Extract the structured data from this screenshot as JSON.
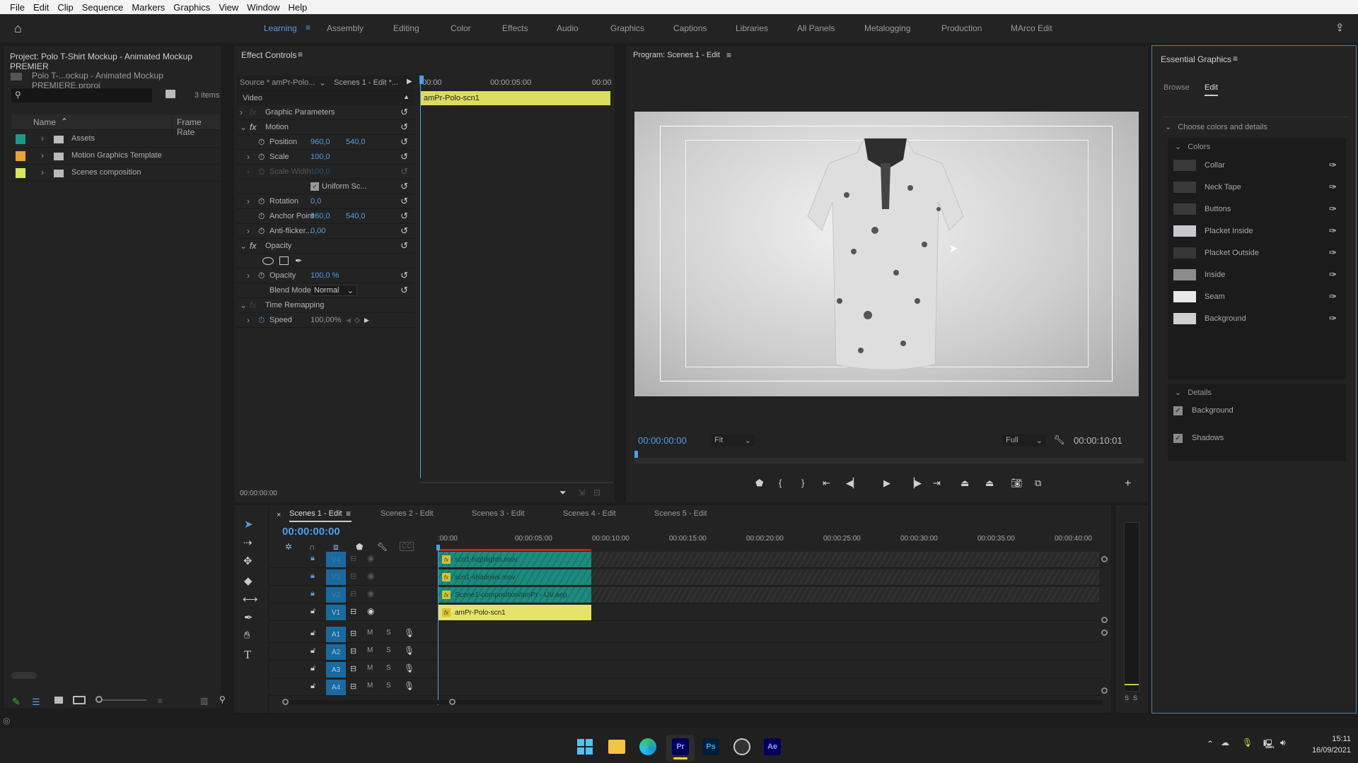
{
  "menu": [
    "File",
    "Edit",
    "Clip",
    "Sequence",
    "Markers",
    "Graphics",
    "View",
    "Window",
    "Help"
  ],
  "workspaces": [
    {
      "label": "Learning",
      "active": true
    },
    {
      "label": "Assembly"
    },
    {
      "label": "Editing"
    },
    {
      "label": "Color"
    },
    {
      "label": "Effects"
    },
    {
      "label": "Audio"
    },
    {
      "label": "Graphics"
    },
    {
      "label": "Captions"
    },
    {
      "label": "Libraries"
    },
    {
      "label": "All Panels"
    },
    {
      "label": "Metalogging"
    },
    {
      "label": "Production"
    },
    {
      "label": "MArco Edit"
    }
  ],
  "project": {
    "title": "Project: Polo T-Shirt Mockup - Animated Mockup PREMIER",
    "file": "Polo T-...ockup - Animated Mockup PREMIERE.prproj",
    "search_placeholder": "",
    "count": "3 items",
    "col_name": "Name",
    "col_framerate": "Frame Rate",
    "items": [
      {
        "name": "Assets",
        "color": "#1a9a8a"
      },
      {
        "name": "Motion Graphics Template",
        "color": "#e8a23a"
      },
      {
        "name": "Scenes composition",
        "color": "#d8e85a"
      }
    ]
  },
  "effect_controls": {
    "title": "Effect Controls",
    "source": "Source * amPr-Polo...",
    "sequence": "Scenes 1 - Edit *...",
    "ruler": [
      "00:00",
      "00:00:05:00",
      "00:00"
    ],
    "clip_name": "amPr-Polo-scn1",
    "video_label": "Video",
    "rows": [
      {
        "label": "Graphic Parameters",
        "type": "fx-dim"
      },
      {
        "label": "Motion",
        "type": "fx"
      },
      {
        "label": "Position",
        "v1": "960,0",
        "v2": "540,0"
      },
      {
        "label": "Scale",
        "v1": "100,0"
      },
      {
        "label": "Scale Width",
        "v1": "100,0",
        "disabled": true
      },
      {
        "label": "Uniform Sc...",
        "type": "check"
      },
      {
        "label": "Rotation",
        "v1": "0,0"
      },
      {
        "label": "Anchor Point",
        "v1": "960,0",
        "v2": "540,0"
      },
      {
        "label": "Anti-flicker...",
        "v1": "0,00"
      },
      {
        "label": "Opacity",
        "type": "fx"
      },
      {
        "label": "",
        "type": "masks"
      },
      {
        "label": "Opacity",
        "v1": "100,0 %"
      },
      {
        "label": "Blend Mode",
        "type": "select",
        "v1": "Normal"
      },
      {
        "label": "Time Remapping",
        "type": "fx-dim"
      },
      {
        "label": "Speed",
        "v1": "100,00%"
      }
    ],
    "timecode": "00:00:00:00"
  },
  "program": {
    "title": "Program: Scenes 1 - Edit",
    "timecode": "00:00:00:00",
    "fit": "Fit",
    "quality": "Full",
    "duration": "00:00:10:01"
  },
  "essential_graphics": {
    "title": "Essential Graphics",
    "tabs": [
      "Browse",
      "Edit"
    ],
    "active_tab": "Edit",
    "section": "Choose colors and details",
    "colors_label": "Colors",
    "colors": [
      {
        "name": "Collar",
        "swatch": "#3a3a3a"
      },
      {
        "name": "Neck Tape",
        "swatch": "#3a3a3a"
      },
      {
        "name": "Buttons",
        "swatch": "#3a3a3a"
      },
      {
        "name": "Placket Inside",
        "swatch": "#c8c8cc"
      },
      {
        "name": "Placket Outside",
        "swatch": "#363636"
      },
      {
        "name": "Inside",
        "swatch": "#8c8c8c"
      },
      {
        "name": "Seam",
        "swatch": "#e8e8e8"
      },
      {
        "name": "Background",
        "swatch": "#d0d0d0"
      }
    ],
    "details_label": "Details",
    "details": [
      {
        "name": "Background",
        "checked": true
      },
      {
        "name": "Shadows",
        "checked": true
      }
    ]
  },
  "timeline": {
    "tabs": [
      "Scenes 1 - Edit",
      "Scenes 2 - Edit",
      "Scenes 3 - Edit",
      "Scenes 4 - Edit",
      "Scenes 5 - Edit"
    ],
    "active_tab": "Scenes 1 - Edit",
    "timecode": "00:00:00:00",
    "ruler": [
      ":00:00",
      "00:00:05:00",
      "00:00:10:00",
      "00:00:15:00",
      "00:00:20:00",
      "00:00:25:00",
      "00:00:30:00",
      "00:00:35:00",
      "00:00:40:00"
    ],
    "video_tracks": [
      "V4",
      "V3",
      "V2",
      "V1"
    ],
    "audio_tracks": [
      "A1",
      "A2",
      "A3",
      "A4"
    ],
    "clips": [
      {
        "track": "V4",
        "name": "scn1-highlights.mov"
      },
      {
        "track": "V3",
        "name": "scn1-shadows.mov"
      },
      {
        "track": "V2",
        "name": "Scene1-composition/amPr - UV.aep"
      },
      {
        "track": "V1",
        "name": "amPr-Polo-scn1"
      }
    ],
    "mute": "M",
    "solo": "S"
  },
  "meter": {
    "labels": [
      "S",
      "S"
    ]
  },
  "taskbar": {
    "apps": [
      "windows-start",
      "file-explorer",
      "edge",
      "Pr",
      "Ps",
      "obs",
      "Ae"
    ],
    "time": "15:11",
    "date": "16/09/2021"
  }
}
